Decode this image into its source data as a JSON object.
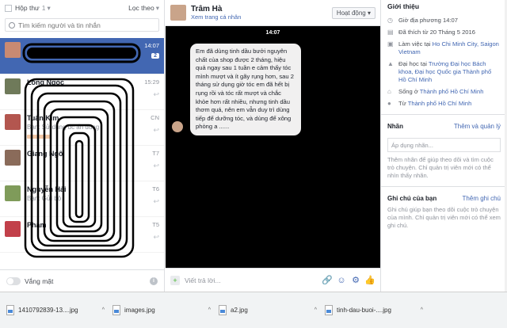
{
  "left": {
    "inbox_label": "Hộp thư",
    "inbox_count": "1",
    "filter_label": "Lọc theo",
    "search_placeholder": "Tìm kiếm người và tin nhắn",
    "threads": [
      {
        "name": "",
        "snippet": "",
        "time": "14:07",
        "badge": "2",
        "active": true,
        "avatar_color": "#c98a72"
      },
      {
        "name": "Long Ngọc",
        "snippet": "",
        "time": "15:29",
        "badge": "",
        "active": false,
        "avatar_color": "#6f7a5a"
      },
      {
        "name": "Tuấn Kim",
        "snippet": "Bạn: Sử dụng đc ấn dung",
        "time": "CN",
        "badge": "",
        "active": false,
        "avatar_color": "#b3564f"
      },
      {
        "name": "Giang Ngô",
        "snippet": "",
        "time": "T7",
        "badge": "",
        "active": false,
        "avatar_color": "#8a6b5a"
      },
      {
        "name": "Nguyễn Hải",
        "snippet": "Bạn: Gửi bộ",
        "time": "T6",
        "badge": "",
        "active": false,
        "avatar_color": "#7f9b5a"
      },
      {
        "name": "Phạm",
        "snippet": "",
        "time": "T5",
        "badge": "",
        "active": false,
        "avatar_color": "#c2404a"
      }
    ],
    "away_label": "Vắng mặt"
  },
  "chat": {
    "contact_name": "Trâm Hà",
    "profile_link": "Xem trang cá nhân",
    "status_button": "Hoạt động",
    "time_divider": "14:07",
    "message": "Em đã dùng tinh dầu bưởi nguyên chất của shop được 2 tháng, hiệu quả ngay sau 1 tuần e cảm thấy tóc mình mượt và ít gãy rụng hơn, sau 2 tháng sử dụng giờ tóc em đã hết bị rụng rồi và tóc rất mượt và chắc khỏe hơn rất nhiều, nhưng tinh dầu thơm quá, nên em vẫn duy trì dùng tiếp để dưỡng tóc, và dùng để xông phòng a ......",
    "composer_placeholder": "Viết trả lời..."
  },
  "right": {
    "intro_title": "Giới thiệu",
    "info": [
      {
        "icon": "clock-icon",
        "text": "Giờ địa phương 14:07",
        "link": ""
      },
      {
        "icon": "calendar-icon",
        "text": "Đã thích từ 20 Tháng 5 2016",
        "link": ""
      },
      {
        "icon": "briefcase-icon",
        "text": "Làm việc tại ",
        "link": "Ho Chi Minh City, Saigon Vietnam"
      },
      {
        "icon": "education-icon",
        "text": "Đại học tại ",
        "link": "Trường Đại học Bách khoa, Đại học Quốc gia Thành phố Hồ Chí Minh"
      },
      {
        "icon": "home-icon",
        "text": "Sống ở ",
        "link": "Thành phố Hồ Chí Minh"
      },
      {
        "icon": "location-icon",
        "text": "Từ ",
        "link": "Thành phố Hồ Chí Minh"
      }
    ],
    "labels_title": "Nhãn",
    "labels_action": "Thêm và quản lý",
    "labels_placeholder": "Áp dụng nhãn...",
    "labels_note": "Thêm nhãn để giúp theo dõi và tìm cuộc trò chuyện. Chỉ quản trị viên mới có thể nhìn thấy nhãn.",
    "notes_title": "Ghi chú của bạn",
    "notes_action": "Thêm ghi chú",
    "notes_note": "Ghi chú giúp bạn theo dõi cuộc trò chuyện của mình. Chỉ quản trị viên mới có thể xem ghi chú."
  },
  "downloads": [
    {
      "name": "1410792839-13....jpg"
    },
    {
      "name": "images.jpg"
    },
    {
      "name": "a2.jpg"
    },
    {
      "name": "tinh-dau-buoi-....jpg"
    }
  ]
}
